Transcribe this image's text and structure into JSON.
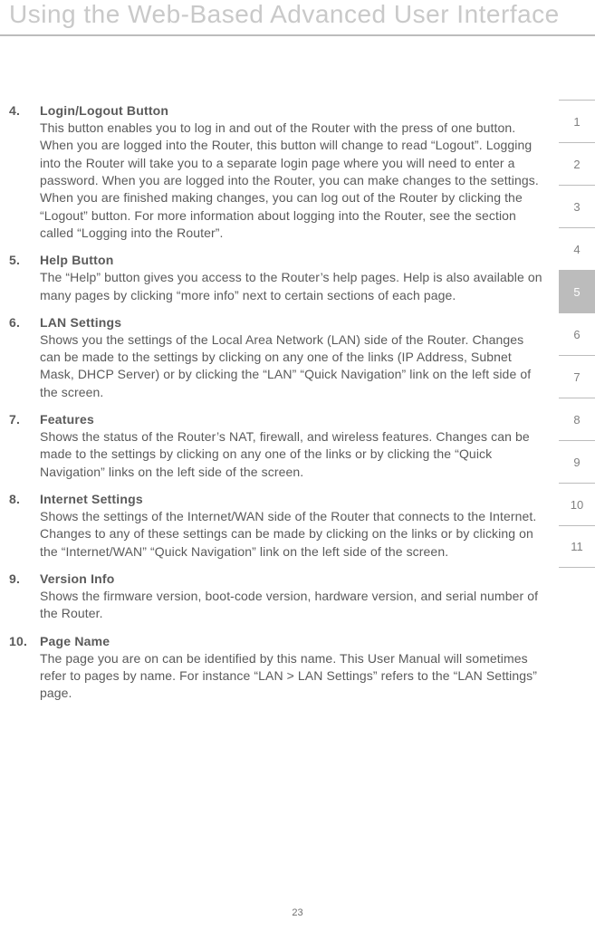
{
  "header": {
    "title": "Using the Web-Based Advanced User Interface"
  },
  "items": [
    {
      "num": "4.",
      "heading": "Login/Logout Button",
      "desc": "This button enables you to log in and out of the Router with the press of one button. When you are logged into the Router, this button will change to read “Logout”. Logging into the Router will take you to a separate login page where you will need to enter a password. When you are logged into the Router, you can make changes to the settings. When you are finished making changes, you can log out of the Router by clicking the “Logout” button. For more information about logging into the Router, see the section called “Logging into the Router”."
    },
    {
      "num": "5.",
      "heading": "Help Button",
      "desc": "The “Help” button gives you access to the Router’s help pages. Help is also available on many pages by clicking “more info” next to certain sections of each page."
    },
    {
      "num": "6.",
      "heading": "LAN Settings",
      "desc": "Shows you the settings of the Local Area Network (LAN) side of the Router. Changes can be made to the settings by clicking on any one of the links (IP Address, Subnet Mask, DHCP Server) or by clicking the “LAN” “Quick Navigation” link on the left side of the screen."
    },
    {
      "num": "7.",
      "heading": "Features",
      "desc": "Shows the status of the Router’s NAT, firewall, and wireless features. Changes can be made to the settings by clicking on any one of the links or by clicking the “Quick Navigation” links on the left side of the screen."
    },
    {
      "num": "8.",
      "heading": "Internet Settings",
      "desc": "Shows the settings of the Internet/WAN side of the Router that connects to the Internet. Changes to any of these settings can be made by clicking on the links or by clicking on the “Internet/WAN” “Quick Navigation” link on the left side of the screen."
    },
    {
      "num": "9.",
      "heading": "Version Info",
      "desc": "Shows the firmware version, boot-code version, hardware version, and serial number of the Router."
    },
    {
      "num": "10.",
      "heading": "Page Name",
      "desc": "The page you are on can be identified by this name. This User Manual will sometimes refer to pages by name. For instance “LAN > LAN Settings” refers to the “LAN Settings” page."
    }
  ],
  "sidenav": [
    "1",
    "2",
    "3",
    "4",
    "5",
    "6",
    "7",
    "8",
    "9",
    "10",
    "11"
  ],
  "sidenav_active_index": 4,
  "page_number": "23"
}
